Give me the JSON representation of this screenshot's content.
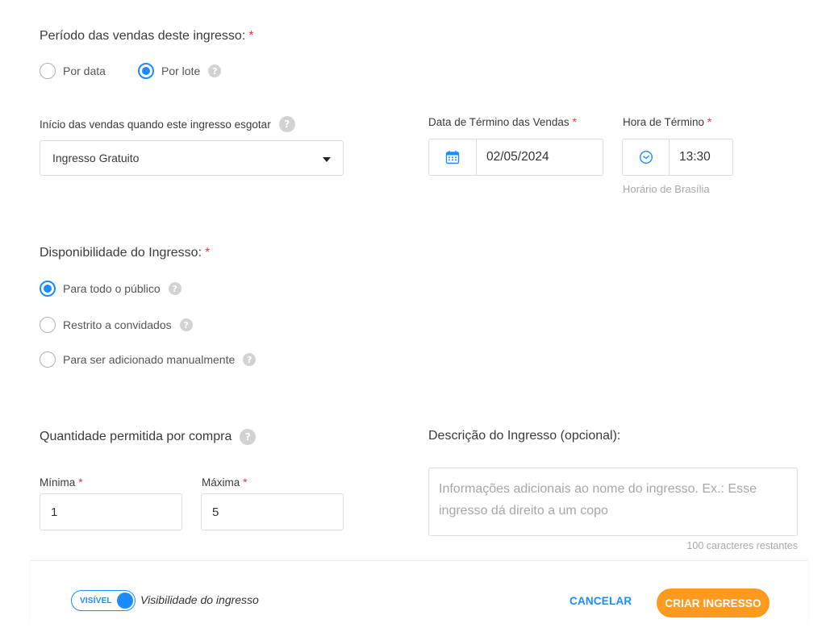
{
  "sales_period": {
    "title": "Período das vendas deste ingresso:",
    "required_mark": "*",
    "options": [
      {
        "label": "Por data",
        "selected": false
      },
      {
        "label": "Por lote",
        "selected": true
      }
    ]
  },
  "start_sales": {
    "label": "Início das vendas quando este ingresso esgotar",
    "selected_value": "Ingresso Gratuito"
  },
  "end_date": {
    "label": "Data de Término das Vendas",
    "required_mark": "*",
    "value": "02/05/2024",
    "icon": "calendar-icon"
  },
  "end_time": {
    "label": "Hora de Término",
    "required_mark": "*",
    "value": "13:30",
    "icon": "clock-icon",
    "hint": "Horário de Brasília"
  },
  "availability": {
    "title": "Disponibilidade do Ingresso:",
    "required_mark": "*",
    "options": [
      {
        "label": "Para todo o público",
        "selected": true
      },
      {
        "label": "Restrito a convidados",
        "selected": false
      },
      {
        "label": "Para ser adicionado manualmente",
        "selected": false
      }
    ]
  },
  "quantity": {
    "title": "Quantidade permitida por compra",
    "min_label": "Mínima",
    "min_value": "1",
    "max_label": "Máxima",
    "max_value": "5",
    "required_mark": "*"
  },
  "description": {
    "title": "Descrição do Ingresso (opcional):",
    "placeholder": "Informações adicionais ao nome do ingresso. Ex.: Esse ingresso dá direito a um copo",
    "remaining": "100 caracteres restantes"
  },
  "footer": {
    "toggle_label": "VISÍVEL",
    "toggle_on": true,
    "toggle_caption": "Visibilidade do ingresso",
    "cancel_label": "CANCELAR",
    "create_label": "CRIAR INGRESSO"
  },
  "colors": {
    "accent": "#1a8cff",
    "primary_button": "#ff9a1f",
    "required": "#e53935"
  },
  "help_glyph": "?"
}
